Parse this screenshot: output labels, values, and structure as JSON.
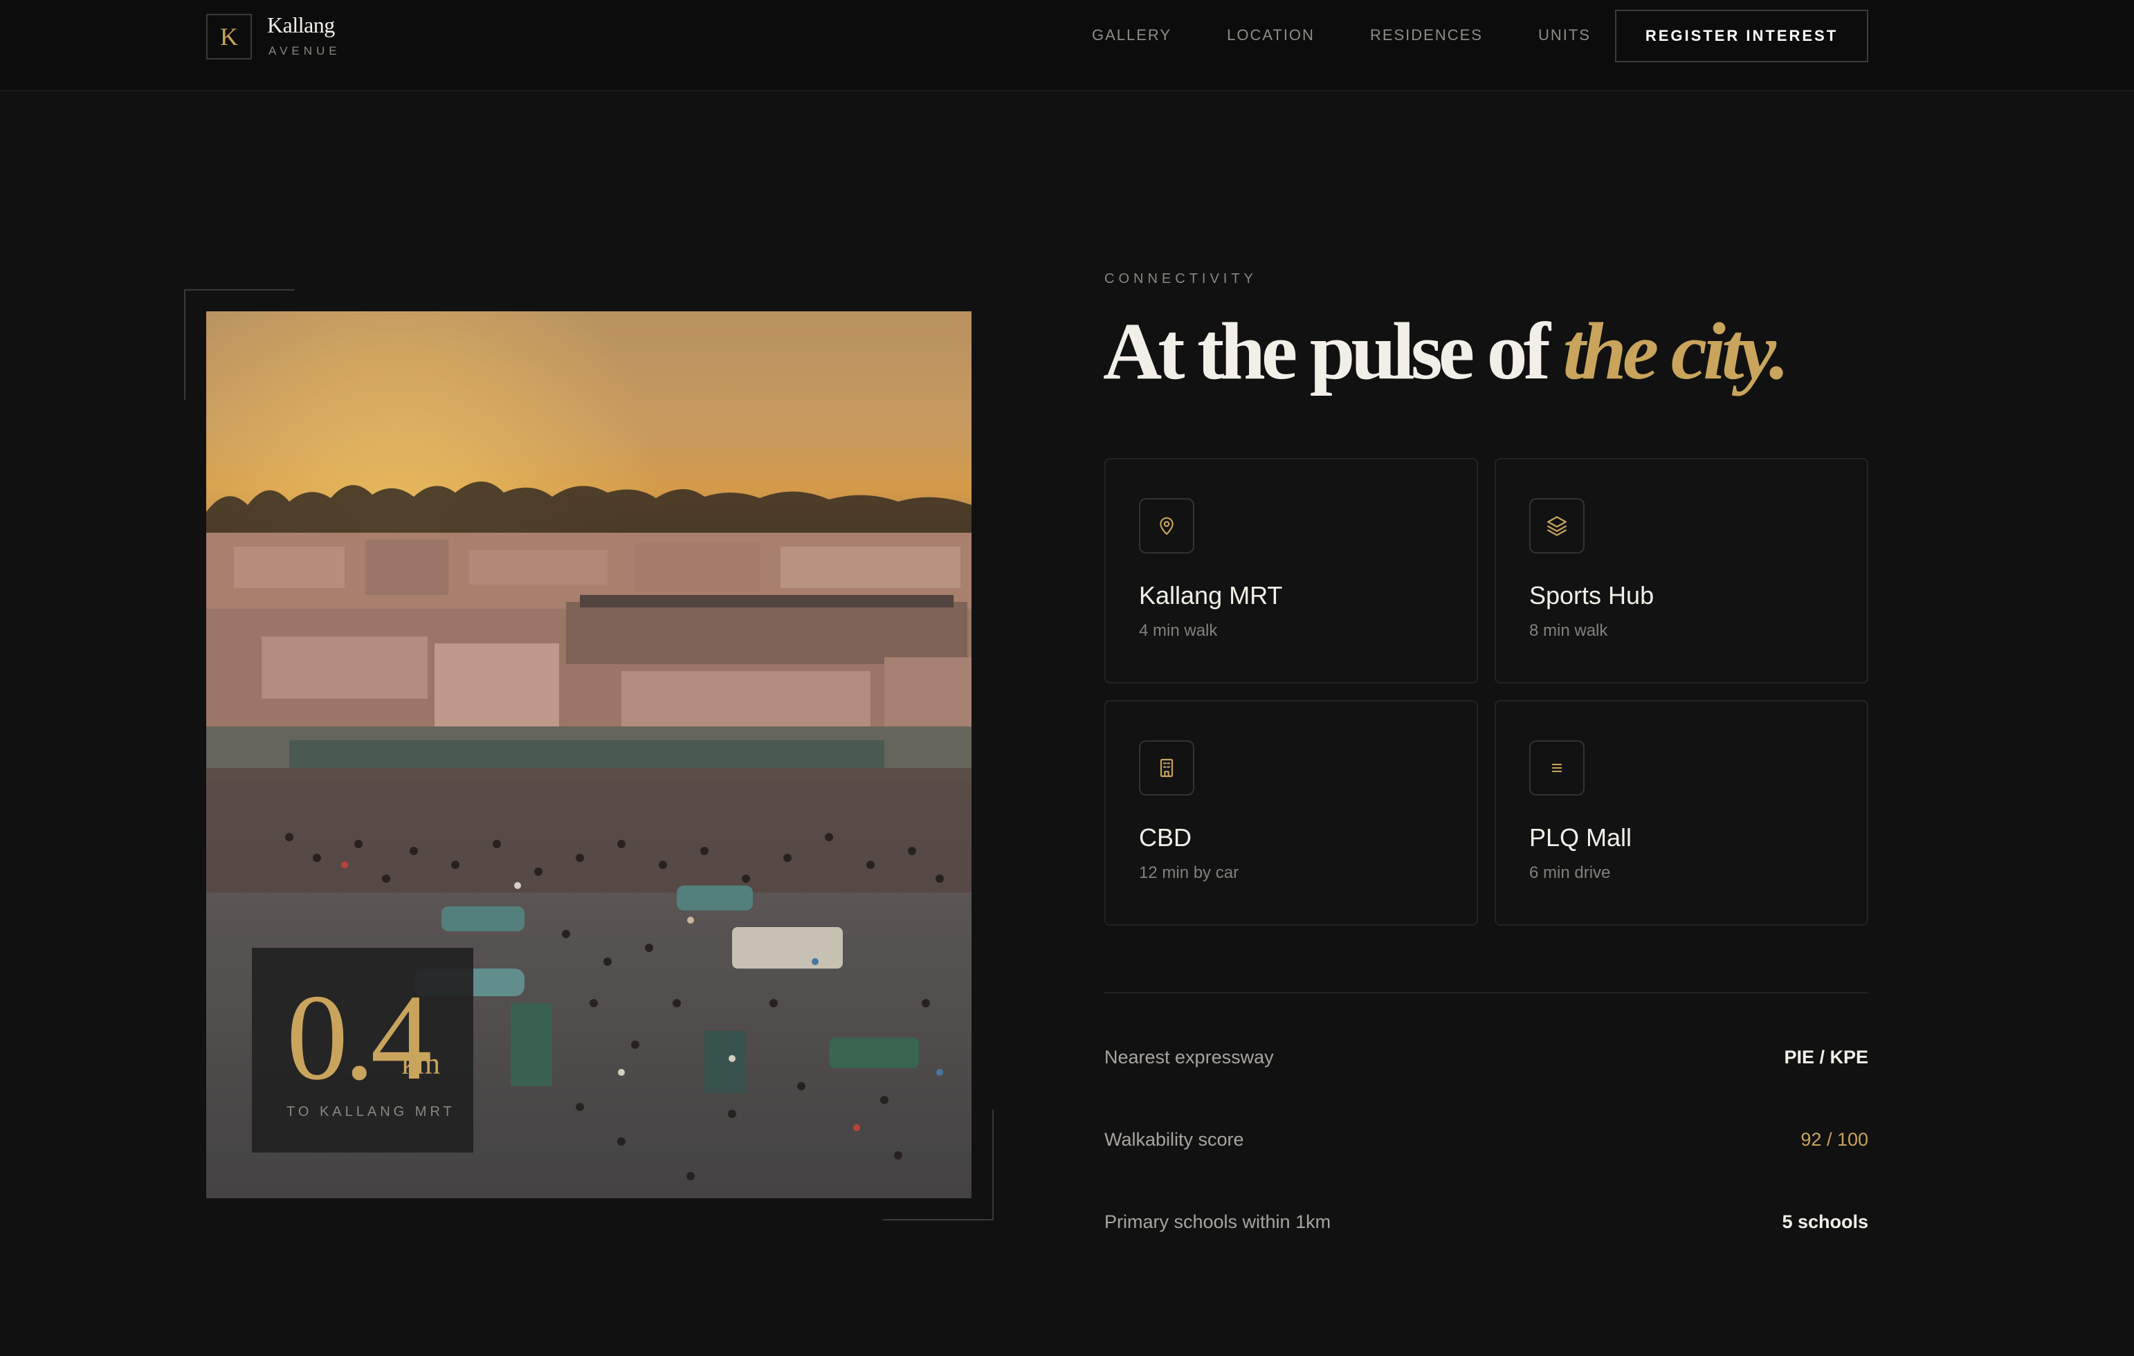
{
  "brand": {
    "mark": "K",
    "name": "Kallang",
    "sub": "AVENUE"
  },
  "nav": {
    "items": [
      {
        "label": "GALLERY"
      },
      {
        "label": "LOCATION"
      },
      {
        "label": "RESIDENCES"
      },
      {
        "label": "UNITS"
      }
    ],
    "cta_label": "REGISTER INTEREST"
  },
  "hero_stat": {
    "value": "0.4",
    "unit": "km",
    "caption": "TO KALLANG MRT"
  },
  "section": {
    "eyebrow": "CONNECTIVITY",
    "headline_main": "At the pulse of ",
    "headline_accent": "the city."
  },
  "places": [
    {
      "title": "Kallang MRT",
      "subtitle": "4 min walk",
      "icon": "map-pin-icon"
    },
    {
      "title": "Sports Hub",
      "subtitle": "8 min walk",
      "icon": "layers-icon"
    },
    {
      "title": "CBD",
      "subtitle": "12 min by car",
      "icon": "building-icon"
    },
    {
      "title": "PLQ Mall",
      "subtitle": "6 min drive",
      "icon": "menu-lines-icon"
    }
  ],
  "facts": [
    {
      "label": "Nearest expressway",
      "value": "PIE / KPE"
    },
    {
      "label": "Walkability score",
      "value": "92 / 100"
    },
    {
      "label": "Primary schools within 1km",
      "value": "5 schools"
    }
  ],
  "colors": {
    "background": "#111111",
    "accent": "#c9a45c",
    "text": "#f2efe8",
    "muted": "#8a8780"
  }
}
